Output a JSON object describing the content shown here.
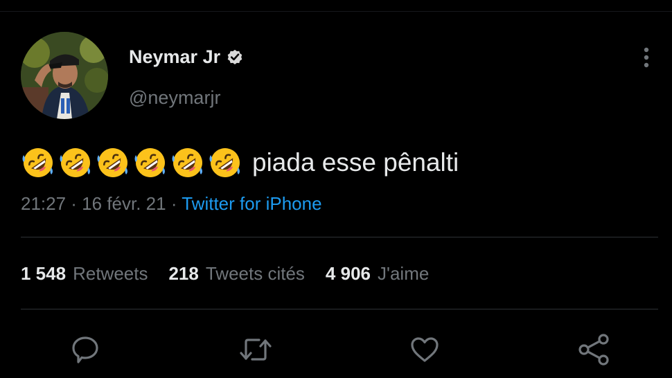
{
  "tweet": {
    "author": {
      "display_name": "Neymar Jr",
      "handle": "@neymarjr",
      "verified": true,
      "avatar_icon": "profile-photo"
    },
    "emoji": {
      "name": "rolling-on-the-floor-laughing",
      "count": 6
    },
    "text": "piada esse pênalti",
    "timestamp": "21:27 · 16 févr. 21",
    "separator": " · ",
    "source": "Twitter for iPhone",
    "stats": {
      "retweets": {
        "count": "1 548",
        "label": "Retweets"
      },
      "quotes": {
        "count": "218",
        "label": "Tweets cités"
      },
      "likes": {
        "count": "4 906",
        "label": "J'aime"
      }
    },
    "actions": [
      {
        "name": "reply",
        "icon": "comment-icon"
      },
      {
        "name": "retweet",
        "icon": "retweet-icon"
      },
      {
        "name": "like",
        "icon": "heart-icon"
      },
      {
        "name": "share",
        "icon": "share-icon"
      }
    ]
  },
  "colors": {
    "background": "#000000",
    "text_primary": "#e7e9ea",
    "text_secondary": "#71767b",
    "accent": "#1d9bf0",
    "divider": "#2f3336"
  }
}
